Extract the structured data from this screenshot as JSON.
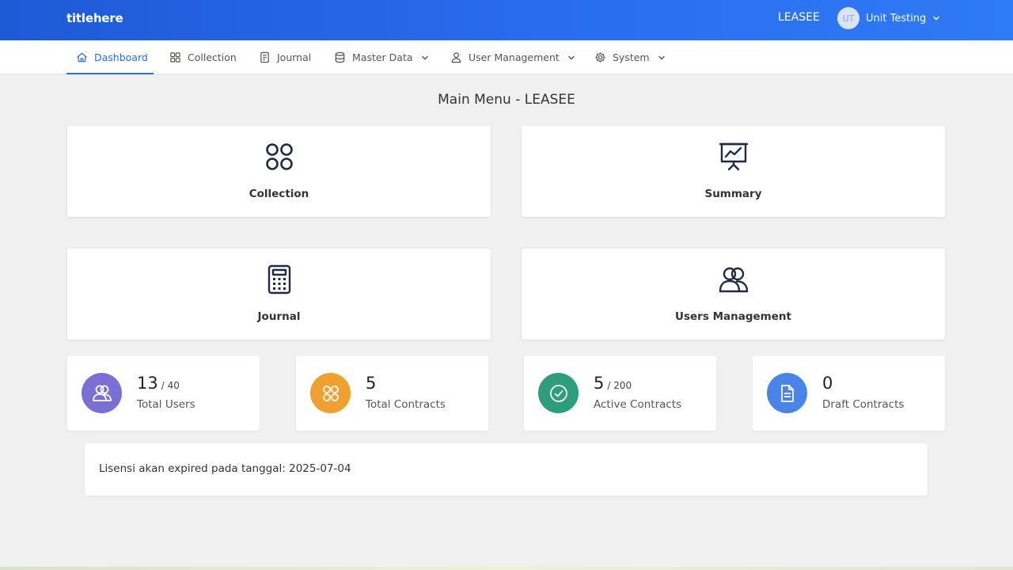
{
  "header": {
    "brand_bold": "title",
    "brand_rest": "here",
    "tenant": "LEASEE",
    "user_initials": "UT",
    "user_name": "Unit Testing"
  },
  "nav": {
    "dashboard": "Dashboard",
    "collection": "Collection",
    "journal": "Journal",
    "master_data": "Master Data",
    "user_management": "User Management",
    "system": "System"
  },
  "page": {
    "title": "Main Menu - LEASEE"
  },
  "menu_cards": {
    "collection": "Collection",
    "summary": "Summary",
    "journal": "Journal",
    "users_management": "Users Management"
  },
  "stats": {
    "total_users": {
      "value": "13",
      "of": "/ 40",
      "label": "Total Users",
      "color": "#7b6fd6"
    },
    "total_contracts": {
      "value": "5",
      "label": "Total Contracts",
      "color": "#f0a031"
    },
    "active_contracts": {
      "value": "5",
      "of": "/ 200",
      "label": "Active Contracts",
      "color": "#2d9d7e"
    },
    "draft_contracts": {
      "value": "0",
      "label": "Draft Contracts",
      "color": "#4a84e8"
    }
  },
  "license": {
    "text": "Lisensi akan expired pada tanggal: 2025-07-04"
  }
}
